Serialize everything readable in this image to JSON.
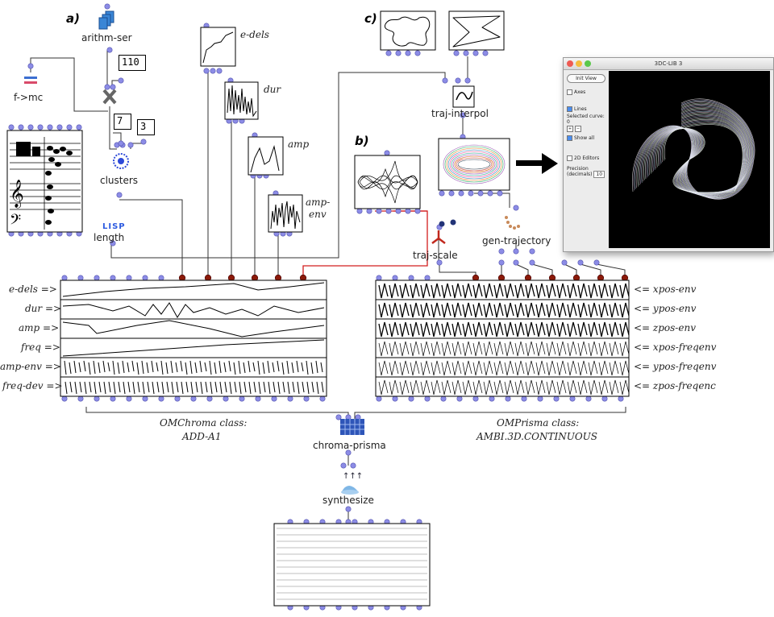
{
  "section_labels": {
    "a": "a)",
    "b": "b)",
    "c": "c)"
  },
  "boxes": {
    "arithm_ser": "arithm-ser",
    "f_to_mc": "f->mc",
    "num_110": "110",
    "num_7": "7",
    "num_3": "3",
    "clusters": "clusters",
    "lisp": "LISP",
    "length": "length",
    "e_dels": "e-dels",
    "dur": "dur",
    "amp": "amp",
    "amp_env_1": "amp-",
    "amp_env_2": "env",
    "traj_interpol": "traj-interpol",
    "traj_scale": "traj-scale",
    "gen_trajectory": "gen-trajectory",
    "chroma_prisma": "chroma-prisma",
    "synthesize": "synthesize"
  },
  "left_params": [
    "e-dels =>",
    "dur =>",
    "amp =>",
    "freq =>",
    "amp-env =>",
    "freq-dev =>"
  ],
  "right_params": [
    "<= xpos-env",
    "<= ypos-env",
    "<= zpos-env",
    "<= xpos-freqenv",
    "<= ypos-freqenv",
    "<= zpos-freqenc"
  ],
  "classes": {
    "omchroma_1": "OMChroma class:",
    "omchroma_2": "ADD-A1",
    "omprisma_1": "OMPrisma class:",
    "omprisma_2": "AMBI.3D.CONTINUOUS"
  },
  "viewer": {
    "title": "3DC-LIB 3",
    "init_view": "Init View",
    "axes": "Axes",
    "lines": "Lines",
    "selected_curve": "Selected curve:",
    "selected_value": "0",
    "plus": "+",
    "minus": "−",
    "show_all": "Show all",
    "editors": "2D Editors",
    "precision": "Precision",
    "precision_unit": "(decimals)",
    "precision_value": "10"
  },
  "colors": {
    "inlet": "#8c8ce6",
    "outlet_red": "#8b1a0a",
    "connection_red": "#d21e1e",
    "connection": "#333333"
  }
}
